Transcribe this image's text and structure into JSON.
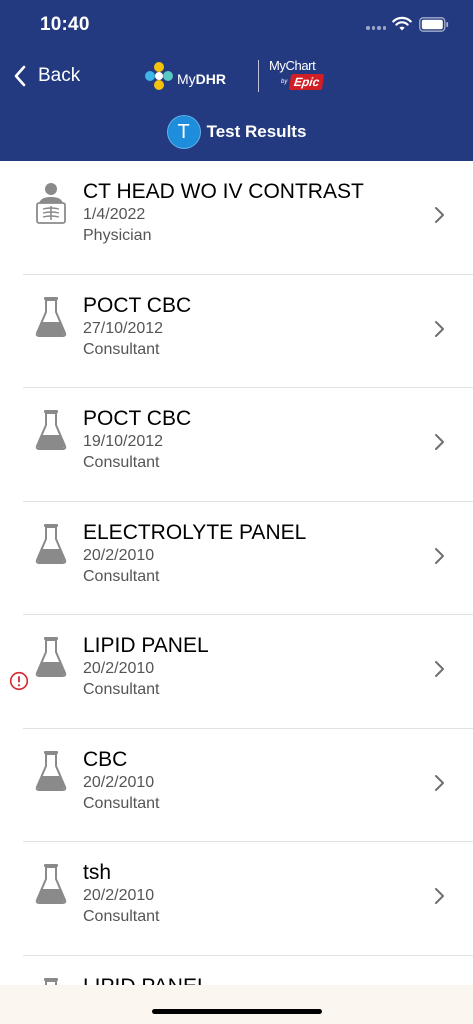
{
  "status_bar": {
    "time": "10:40",
    "wifi_icon": "wifi-icon",
    "battery_icon": "battery-icon"
  },
  "header": {
    "back_label": "Back",
    "logo_mydhr": {
      "my": "My",
      "dhr": "DHR"
    },
    "logo_mychart": {
      "mychart": "MyChart",
      "by": "by",
      "epic": "Epic"
    },
    "avatar_letter": "T",
    "title": "Test Results",
    "colors": {
      "background": "#233a80",
      "avatar": "#1e8ddb",
      "epic": "#d21f26"
    }
  },
  "results": [
    {
      "title": "CT HEAD WO IV CONTRAST",
      "date": "1/4/2022",
      "role": "Physician",
      "icon": "imaging-icon",
      "alert": false
    },
    {
      "title": "POCT CBC",
      "date": "27/10/2012",
      "role": "Consultant",
      "icon": "lab-flask-icon",
      "alert": false
    },
    {
      "title": "POCT CBC",
      "date": "19/10/2012",
      "role": "Consultant",
      "icon": "lab-flask-icon",
      "alert": false
    },
    {
      "title": "ELECTROLYTE PANEL",
      "date": "20/2/2010",
      "role": "Consultant",
      "icon": "lab-flask-icon",
      "alert": false
    },
    {
      "title": "LIPID PANEL",
      "date": "20/2/2010",
      "role": "Consultant",
      "icon": "lab-flask-icon",
      "alert": true
    },
    {
      "title": "CBC",
      "date": "20/2/2010",
      "role": "Consultant",
      "icon": "lab-flask-icon",
      "alert": false
    },
    {
      "title": "tsh",
      "date": "20/2/2010",
      "role": "Consultant",
      "icon": "lab-flask-icon",
      "alert": false
    },
    {
      "title": "LIPID PANEL",
      "date": "",
      "role": "",
      "icon": "lab-flask-icon",
      "alert": false
    }
  ]
}
